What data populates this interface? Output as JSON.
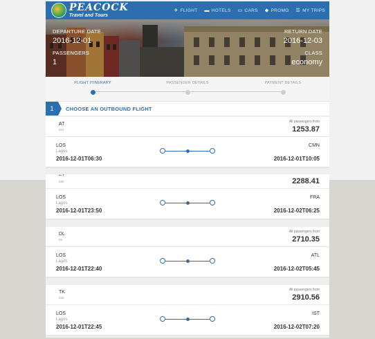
{
  "nav": {
    "logo_name": "PEACOCK",
    "logo_sub": "Travel and Tours",
    "links": [
      {
        "label": "FLIGHT",
        "icon": "plane-icon"
      },
      {
        "label": "HOTELS",
        "icon": "bed-icon"
      },
      {
        "label": "CARS",
        "icon": "car-icon"
      },
      {
        "label": "PROMO",
        "icon": "tag-icon"
      },
      {
        "label": "MY TRIPS",
        "icon": "list-icon"
      }
    ]
  },
  "hero": {
    "departure_label": "DEPARTURE DATE",
    "departure_value": "2016-12-01",
    "return_label": "RETURN DATE",
    "return_value": "2016-12-03",
    "passengers_label": "PASSENGERS",
    "passengers_value": "1",
    "class_label": "CLASS",
    "class_value": "economy"
  },
  "steps": [
    {
      "label": "FLIGHT ITINERARY",
      "active": true
    },
    {
      "label": "PASSENGER DETAILS",
      "active": false
    },
    {
      "label": "PAYMENT DETAILS",
      "active": false
    }
  ],
  "section": {
    "number": "1",
    "title": "CHOOSE AN OUTBOUND FLIGHT"
  },
  "flights": [
    {
      "airline": "AT",
      "flight_no": "554",
      "price_label": "All passengers from",
      "price": "1253.87",
      "origin": "LOS",
      "origin_city": "Lagos",
      "departure": "2016-12-01T06:30",
      "destination": "CMN",
      "arrival": "2016-12-01T10:05"
    },
    {
      "airline": "ET",
      "flight_no": "569",
      "price_label": "",
      "price": "2288.41",
      "origin": "LOS",
      "origin_city": "Lagos",
      "departure": "2016-12-01T23:50",
      "destination": "FRA",
      "arrival": "2016-12-02T06:25"
    },
    {
      "airline": "DL",
      "flight_no": "55",
      "price_label": "All passengers from",
      "price": "2710.35",
      "origin": "LOS",
      "origin_city": "Lagos",
      "departure": "2016-12-01T22:40",
      "destination": "ATL",
      "arrival": "2016-12-02T05:45"
    },
    {
      "airline": "TK",
      "flight_no": "626",
      "price_label": "All passengers from",
      "price": "2910.56",
      "origin": "LOS",
      "origin_city": "Lagos",
      "departure": "2016-12-01T22:45",
      "destination": "IST",
      "arrival": "2016-12-02T07:20"
    }
  ],
  "colors": {
    "primary": "#2c6fb0",
    "nav": "#2c6fb0"
  }
}
